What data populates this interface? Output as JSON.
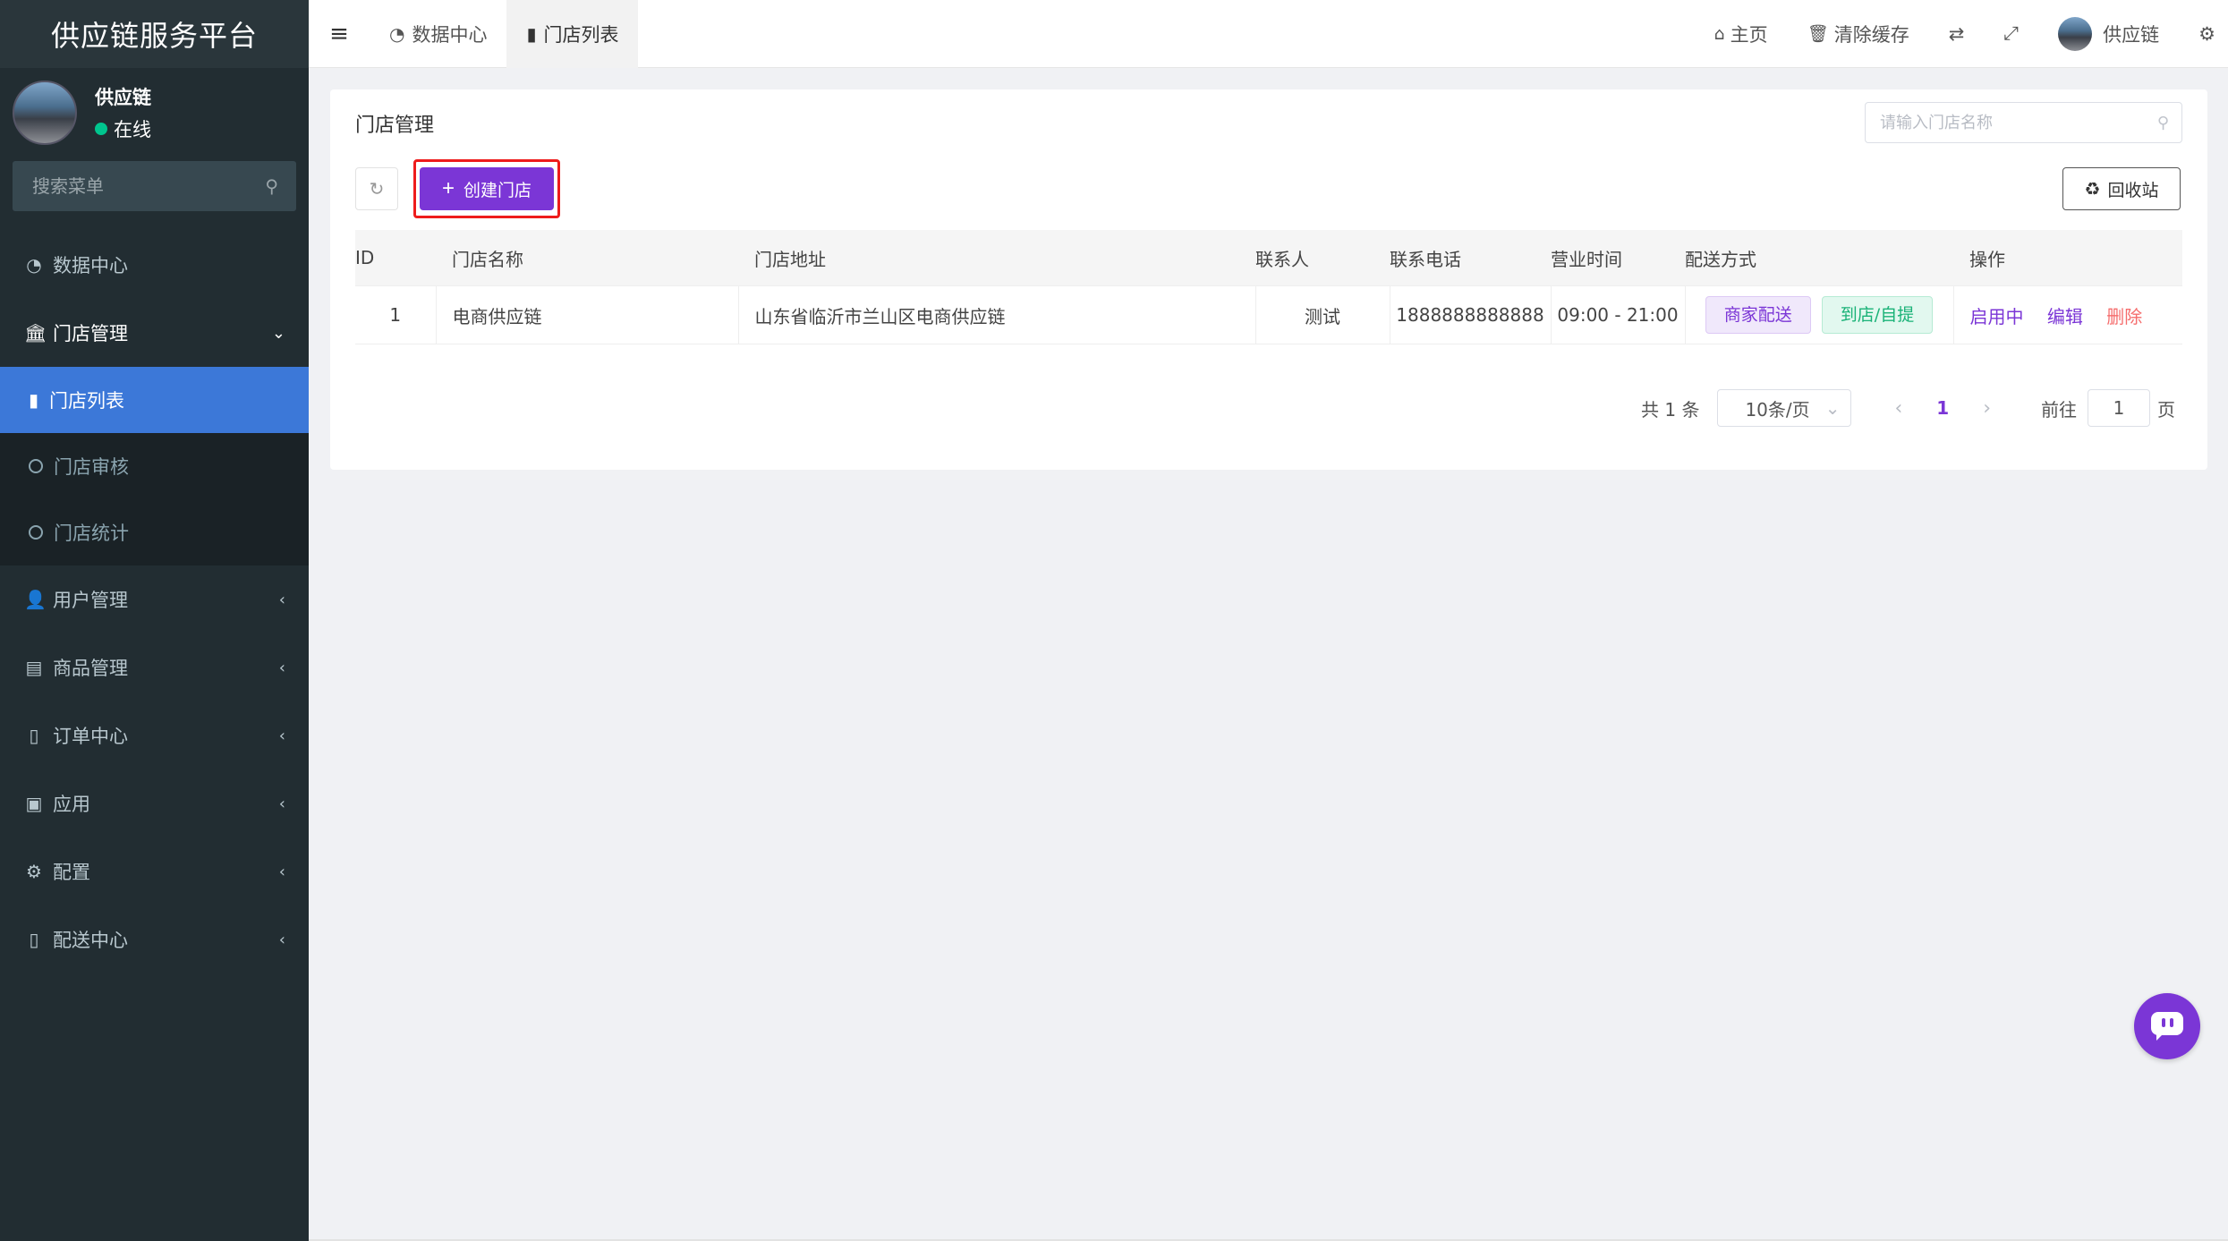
{
  "sidebar": {
    "brand": "供应链服务平台",
    "user_name": "供应链",
    "user_status": "在线",
    "search_placeholder": "搜索菜单",
    "items": {
      "dashboard": "数据中心",
      "store_mgmt": "门店管理",
      "store_list": "门店列表",
      "store_review": "门店审核",
      "store_stats": "门店统计",
      "user_mgmt": "用户管理",
      "goods_mgmt": "商品管理",
      "order_center": "订单中心",
      "apps": "应用",
      "config": "配置",
      "delivery_center": "配送中心"
    }
  },
  "header": {
    "tabs": [
      "数据中心",
      "门店列表"
    ],
    "home": "主页",
    "clear_cache": "清除缓存",
    "user_name": "供应链"
  },
  "main": {
    "title": "门店管理",
    "search_placeholder": "请输入门店名称",
    "create_button": "创建门店",
    "recycle_button": "回收站",
    "columns": [
      "ID",
      "门店名称",
      "门店地址",
      "联系人",
      "联系电话",
      "营业时间",
      "配送方式",
      "操作"
    ],
    "rows": [
      {
        "id": "1",
        "name": "电商供应链",
        "address": "山东省临沂市兰山区电商供应链",
        "contact": "测试",
        "phone": "1888888888888",
        "hours": "09:00 - 21:00",
        "delivery_tags": [
          "商家配送",
          "到店/自提"
        ],
        "actions": [
          "启用中",
          "编辑",
          "删除"
        ]
      }
    ],
    "pagination": {
      "total": "共 1 条",
      "page_size": "10条/页",
      "current_page": "1",
      "goto_label": "前往",
      "goto_value": "1",
      "page_suffix": "页"
    }
  },
  "colors": {
    "accent": "#7b36d6",
    "sidebar_bg": "#222d32",
    "active_menu": "#3c78d8",
    "highlight_box": "#ee1c1c",
    "delete": "#f56c6c",
    "success": "#19b277"
  }
}
